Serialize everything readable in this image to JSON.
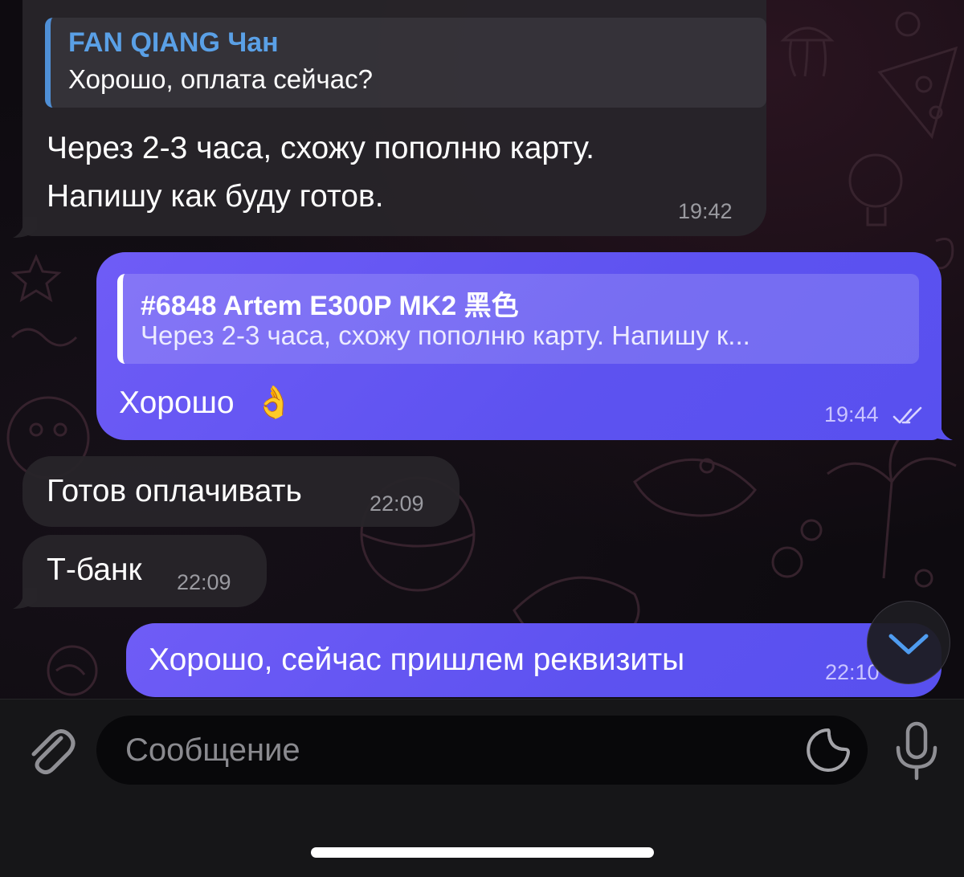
{
  "messages": [
    {
      "direction": "incoming",
      "reply_to": {
        "name": "FAN QIANG Чан",
        "text": "Хорошо, оплата сейчас?"
      },
      "lines": [
        "Через 2-3 часа, схожу пополню карту.",
        "Напишу как буду готов."
      ],
      "time": "19:42"
    },
    {
      "direction": "outgoing",
      "reply_to": {
        "name": "#6848 Artem E300P MK2 黑色",
        "text": "Через 2-3 часа, схожу пополню карту. Напишу к..."
      },
      "text": "Хорошо",
      "emoji": "👌",
      "time": "19:44",
      "status": "read"
    },
    {
      "direction": "incoming",
      "text": "Готов оплачивать",
      "time": "22:09"
    },
    {
      "direction": "incoming",
      "text": "Т-банк",
      "time": "22:09"
    },
    {
      "direction": "outgoing",
      "text": "Хорошо, сейчас пришлем реквизиты",
      "time": "22:10"
    }
  ],
  "composer": {
    "placeholder": "Сообщение"
  },
  "colors": {
    "incoming_bubble": "#28242a",
    "outgoing_bubble": "#5f54f1",
    "reply_accent": "#4f8fd6",
    "reply_name": "#5aa0e6"
  }
}
